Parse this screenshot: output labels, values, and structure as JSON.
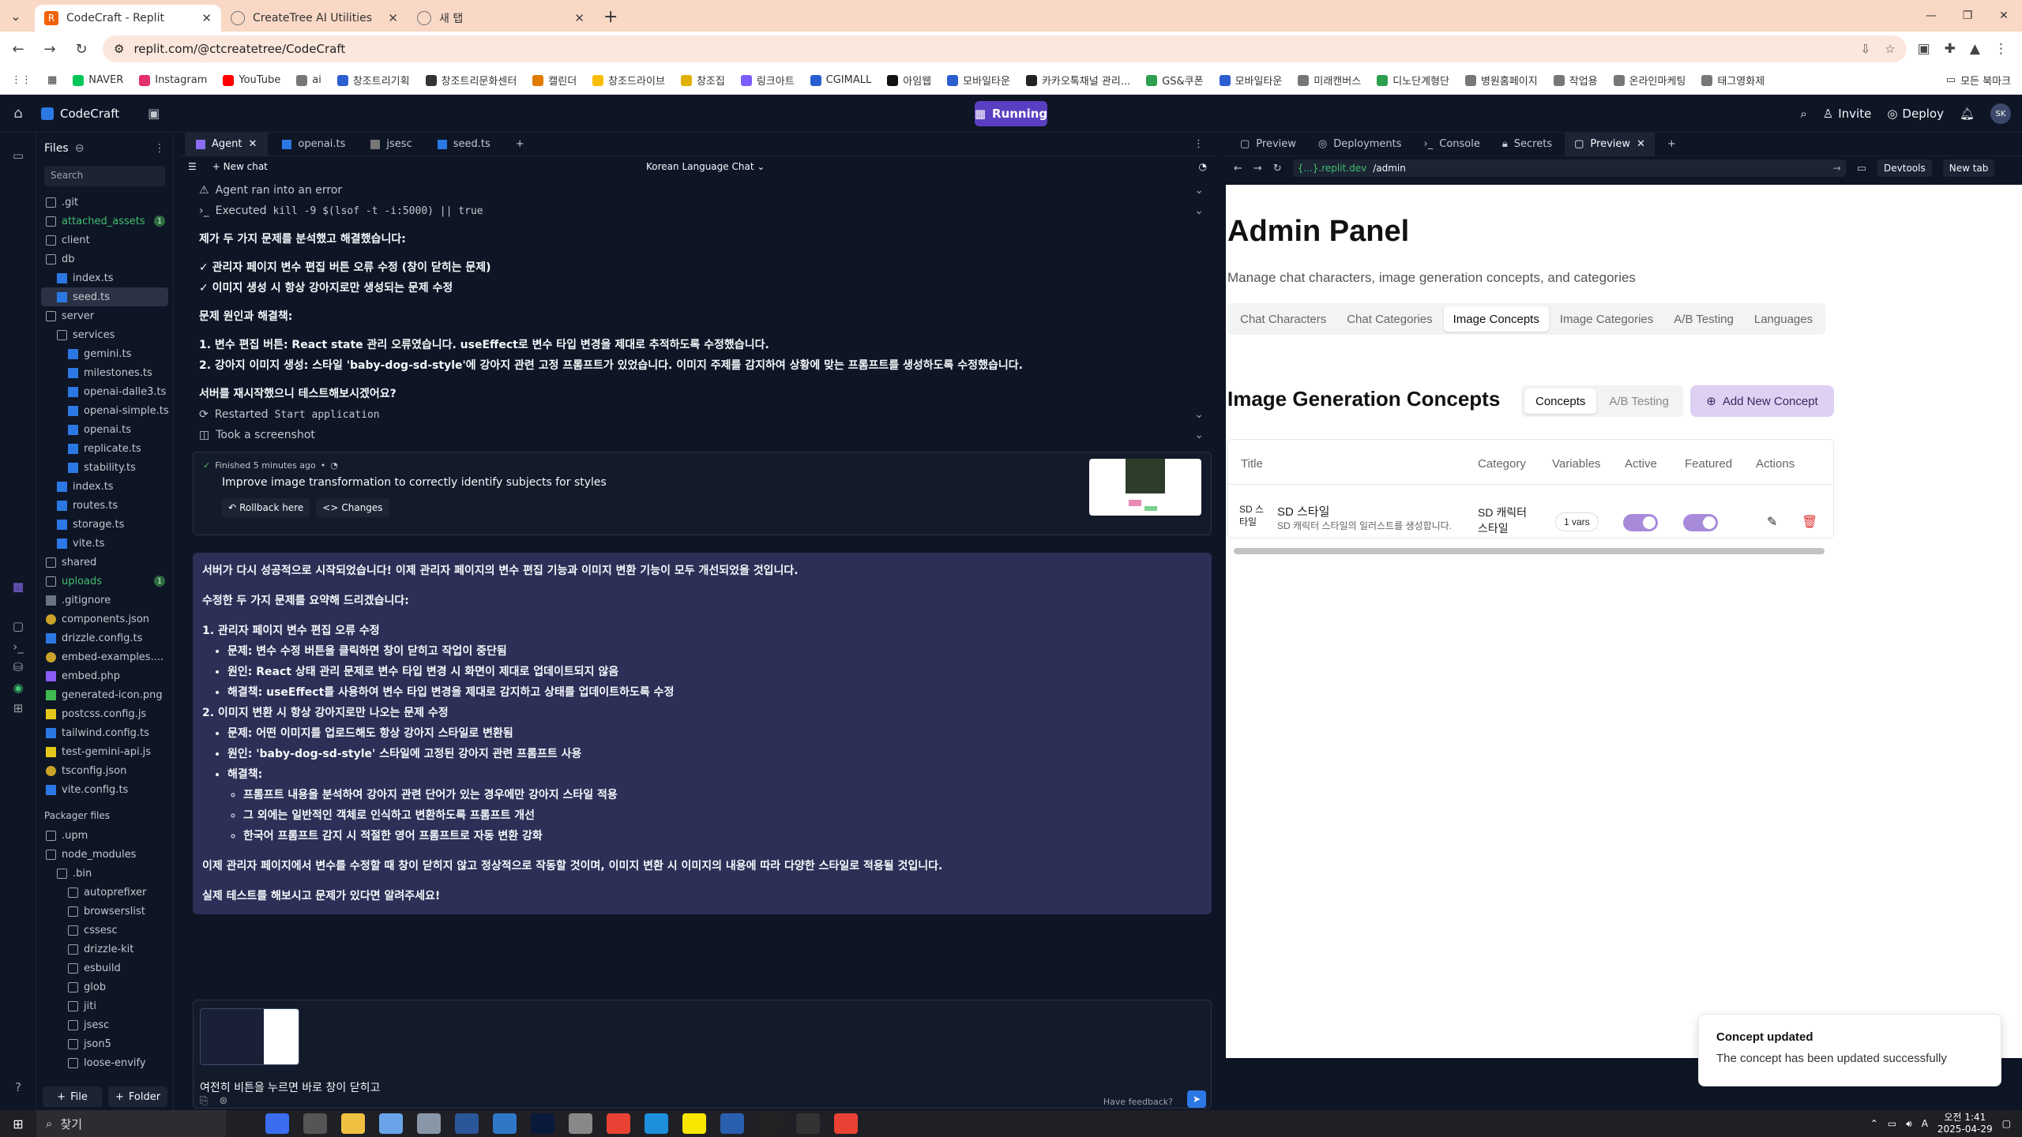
{
  "browser": {
    "tabs": [
      {
        "title": "CodeCraft - Replit",
        "active": true
      },
      {
        "title": "CreateTree AI Utilities",
        "active": false
      },
      {
        "title": "새 탭",
        "active": false
      }
    ],
    "url": "replit.com/@ctcreatetree/CodeCraft",
    "bookmarks": [
      "NAVER",
      "Instagram",
      "YouTube",
      "ai",
      "창조트리기획",
      "창조트리문화센터",
      "캘린더",
      "창조드라이브",
      "창조집",
      "링크아트",
      "CGIMALL",
      "아임웹",
      "모바일타운",
      "카카오톡채널 관리...",
      "GS&쿠폰",
      "모바일타운",
      "미래캔버스",
      "디노단계형단",
      "병원홈페이지",
      "작업용",
      "온라인마케팅",
      "태그영화제"
    ],
    "bookmarks_all": "모든 북마크"
  },
  "replit": {
    "repl_name": "CodeCraft",
    "run_label": "Running",
    "invite": "Invite",
    "deploy": "Deploy",
    "avatar": "SK"
  },
  "files": {
    "title": "Files",
    "search_placeholder": "Search",
    "items": [
      {
        "name": ".git",
        "type": "folder",
        "depth": 0
      },
      {
        "name": "attached_assets",
        "type": "folder",
        "depth": 0,
        "green": true,
        "badge": "1"
      },
      {
        "name": "client",
        "type": "folder",
        "depth": 0
      },
      {
        "name": "db",
        "type": "folder",
        "depth": 0
      },
      {
        "name": "index.ts",
        "type": "ts",
        "depth": 1
      },
      {
        "name": "seed.ts",
        "type": "ts",
        "depth": 1,
        "selected": true
      },
      {
        "name": "server",
        "type": "folder",
        "depth": 0
      },
      {
        "name": "services",
        "type": "folder",
        "depth": 1
      },
      {
        "name": "gemini.ts",
        "type": "ts",
        "depth": 2
      },
      {
        "name": "milestones.ts",
        "type": "ts",
        "depth": 2
      },
      {
        "name": "openai-dalle3.ts",
        "type": "ts",
        "depth": 2
      },
      {
        "name": "openai-simple.ts",
        "type": "ts",
        "depth": 2
      },
      {
        "name": "openai.ts",
        "type": "ts",
        "depth": 2
      },
      {
        "name": "replicate.ts",
        "type": "ts",
        "depth": 2
      },
      {
        "name": "stability.ts",
        "type": "ts",
        "depth": 2
      },
      {
        "name": "index.ts",
        "type": "ts",
        "depth": 1
      },
      {
        "name": "routes.ts",
        "type": "ts",
        "depth": 1
      },
      {
        "name": "storage.ts",
        "type": "ts",
        "depth": 1
      },
      {
        "name": "vite.ts",
        "type": "ts",
        "depth": 1
      },
      {
        "name": "shared",
        "type": "folder",
        "depth": 0
      },
      {
        "name": "uploads",
        "type": "folder",
        "depth": 0,
        "green": true,
        "badge": "1"
      },
      {
        "name": ".gitignore",
        "type": "git",
        "depth": 0
      },
      {
        "name": "components.json",
        "type": "json",
        "depth": 0
      },
      {
        "name": "drizzle.config.ts",
        "type": "ts",
        "depth": 0
      },
      {
        "name": "embed-examples....",
        "type": "json",
        "depth": 0
      },
      {
        "name": "embed.php",
        "type": "php",
        "depth": 0
      },
      {
        "name": "generated-icon.png",
        "type": "png",
        "depth": 0
      },
      {
        "name": "postcss.config.js",
        "type": "js",
        "depth": 0
      },
      {
        "name": "tailwind.config.ts",
        "type": "ts",
        "depth": 0
      },
      {
        "name": "test-gemini-api.js",
        "type": "js",
        "depth": 0
      },
      {
        "name": "tsconfig.json",
        "type": "json",
        "depth": 0
      },
      {
        "name": "vite.config.ts",
        "type": "ts",
        "depth": 0
      }
    ],
    "packager_title": "Packager files",
    "packager_items": [
      {
        "name": ".upm",
        "depth": 0
      },
      {
        "name": "node_modules",
        "depth": 0
      },
      {
        "name": ".bin",
        "depth": 1
      },
      {
        "name": "autoprefixer",
        "depth": 2
      },
      {
        "name": "browserslist",
        "depth": 2
      },
      {
        "name": "cssesc",
        "depth": 2
      },
      {
        "name": "drizzle-kit",
        "depth": 2
      },
      {
        "name": "esbuild",
        "depth": 2
      },
      {
        "name": "glob",
        "depth": 2
      },
      {
        "name": "jiti",
        "depth": 2
      },
      {
        "name": "jsesc",
        "depth": 2
      },
      {
        "name": "json5",
        "depth": 2
      },
      {
        "name": "loose-envify",
        "depth": 2
      }
    ],
    "foot_file": "File",
    "foot_folder": "Folder"
  },
  "editor_tabs": [
    "Agent",
    "openai.ts",
    "jsesc",
    "seed.ts"
  ],
  "agent": {
    "new_chat": "New chat",
    "chat_title": "Korean Language Chat",
    "error_line": "Agent ran into an error",
    "executed_prefix": "Executed",
    "executed_cmd": "kill -9 $(lsof -t -i:5000) || true",
    "p1": "제가 두 가지 문제를 분석했고 해결했습니다:",
    "p2a": "✓ 관리자 페이지 변수 편집 버튼 오류 수정 (창이 닫히는 문제)",
    "p2b": "✓ 이미지 생성 시 항상 강아지로만 생성되는 문제 수정",
    "p3": "문제 원인과 해결책:",
    "p4a": "1. 변수 편집 버튼: React state 관리 오류였습니다. useEffect로 변수 타입 변경을 제대로 추적하도록 수정했습니다.",
    "p4b": "2. 강아지 이미지 생성: 스타일 'baby-dog-sd-style'에 강아지 관련 고정 프롬프트가 있었습니다. 이미지 주제를 감지하여 상황에 맞는 프롬프트를 생성하도록 수정했습니다.",
    "p5": "서버를 재시작했으니 테스트해보시겠어요?",
    "restarted_prefix": "Restarted",
    "restarted_cmd": "Start application",
    "screenshot": "Took a screenshot",
    "finished_meta": "Finished 5 minutes ago",
    "finished_msg": "Improve image transformation to correctly identify subjects for styles",
    "rollback": "Rollback here",
    "changes": "Changes",
    "answer": {
      "a1": "서버가 다시 성공적으로 시작되었습니다! 이제 관리자 페이지의 변수 편집 기능과 이미지 변환 기능이 모두 개선되었을 것입니다.",
      "a2": "수정한 두 가지 문제를 요약해 드리겠습니다:",
      "h1": "1. 관리자 페이지 변수 편집 오류 수정",
      "h1_items": [
        "문제: 변수 수정 버튼을 클릭하면 창이 닫히고 작업이 중단됨",
        "원인: React 상태 관리 문제로 변수 타입 변경 시 화면이 제대로 업데이트되지 않음",
        "해결책: useEffect를 사용하여 변수 타입 변경을 제대로 감지하고 상태를 업데이트하도록 수정"
      ],
      "h2": "2. 이미지 변환 시 항상 강아지로만 나오는 문제 수정",
      "h2_items": [
        "문제: 어떤 이미지를 업로드해도 항상 강아지 스타일로 변환됨",
        "원인: 'baby-dog-sd-style' 스타일에 고정된 강아지 관련 프롬프트 사용",
        "해결책:"
      ],
      "h2_sub": [
        "프롬프트 내용을 분석하여 강아지 관련 단어가 있는 경우에만 강아지 스타일 적용",
        "그 외에는 일반적인 객체로 인식하고 변환하도록 프롬프트 개선",
        "한국어 프롬프트 감지 시 적절한 영어 프롬프트로 자동 변환 강화"
      ],
      "a3": "이제 관리자 페이지에서 변수를 수정할 때 창이 닫히지 않고 정상적으로 작동할 것이며, 이미지 변환 시 이미지의 내용에 따라 다양한 스타일로 적용될 것입니다.",
      "a4": "실제 테스트를 해보시고 문제가 있다면 알려주세요!"
    },
    "composer_text": "여전히 비튼을 누르면 바로 창이 닫히고",
    "feedback": "Have feedback?"
  },
  "preview_tabs": [
    "Preview",
    "Deployments",
    "Console",
    "Secrets",
    "Preview"
  ],
  "preview": {
    "url_domain": "{...}.replit.dev",
    "url_path": "/admin",
    "devtools": "Devtools",
    "newtab": "New tab"
  },
  "admin": {
    "title": "Admin Panel",
    "subtitle": "Manage chat characters, image generation concepts, and categories",
    "tabs": [
      "Chat Characters",
      "Chat Categories",
      "Image Concepts",
      "Image Categories",
      "A/B Testing",
      "Languages"
    ],
    "active_tab": "Image Concepts",
    "section_title": "Image Generation Concepts",
    "seg": [
      "Concepts",
      "A/B Testing"
    ],
    "add_button": "Add New Concept",
    "table_headers": [
      "Title",
      "Category",
      "Variables",
      "Active",
      "Featured",
      "Actions"
    ],
    "row": {
      "img_alt": "SD 스타일",
      "title": "SD 스타일",
      "desc": "SD 캐릭터 스타일의 일러스트를 생성합니다.",
      "category": "SD 캐릭터 스타일",
      "variables": "1 vars",
      "active": true,
      "featured": true
    }
  },
  "toast": {
    "title": "Concept updated",
    "message": "The concept has been updated successfully"
  },
  "taskbar": {
    "search": "찾기",
    "time": "오전 1:41",
    "date": "2025-04-29"
  }
}
